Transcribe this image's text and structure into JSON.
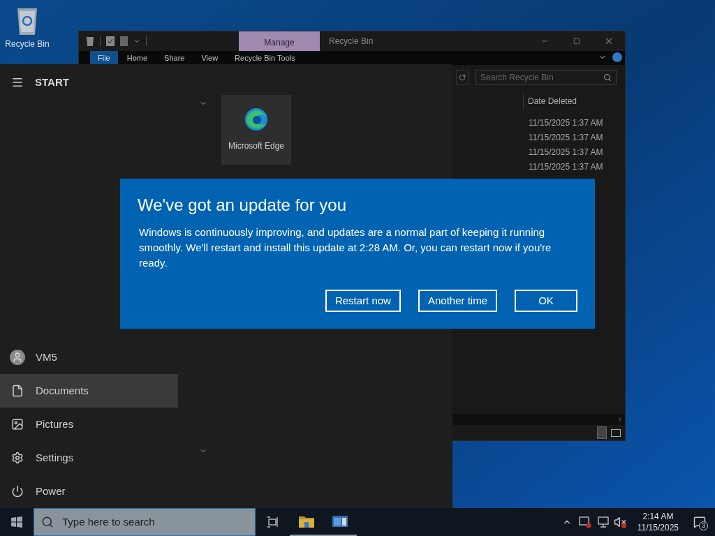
{
  "desktop_icons": [
    {
      "kind": "recycle_bin",
      "label": "Recycle Bin"
    }
  ],
  "explorer": {
    "context_tab": "Manage",
    "title": "Recycle Bin",
    "ribbon_tabs": [
      {
        "label": "File",
        "selected": true
      },
      {
        "label": "Home",
        "selected": false
      },
      {
        "label": "Share",
        "selected": false
      },
      {
        "label": "View",
        "selected": false
      },
      {
        "label": "Recycle Bin Tools",
        "selected": false
      }
    ],
    "search": {
      "placeholder": "Search Recycle Bin"
    },
    "columns": [
      "Date Deleted"
    ],
    "rows": [
      "11/15/2025 1:37 AM",
      "11/15/2025 1:37 AM",
      "11/15/2025 1:37 AM",
      "11/15/2025 1:37 AM"
    ]
  },
  "start_menu": {
    "title": "START",
    "tiles": [
      {
        "label": "Microsoft Edge"
      }
    ],
    "items": [
      {
        "kind": "account",
        "label": "VM5",
        "selected": false
      },
      {
        "kind": "documents",
        "label": "Documents",
        "selected": true
      },
      {
        "kind": "pictures",
        "label": "Pictures",
        "selected": false
      },
      {
        "kind": "settings",
        "label": "Settings",
        "selected": false
      },
      {
        "kind": "power",
        "label": "Power",
        "selected": false
      }
    ]
  },
  "dialog": {
    "title": "We've got an update for you",
    "message": "Windows is continuously improving, and updates are a normal part of keeping it running smoothly. We'll restart and install this update at 2:28 AM. Or, you can restart now if you're ready.",
    "buttons": [
      "Restart now",
      "Another time",
      "OK"
    ]
  },
  "taskbar": {
    "search": {
      "placeholder": "Type here to search"
    },
    "apps": [
      {
        "kind": "task_view",
        "running": false
      },
      {
        "kind": "file_explorer",
        "running": true
      },
      {
        "kind": "window_app",
        "running": true
      }
    ],
    "clock": {
      "time": "2:14 AM",
      "date": "11/15/2025"
    },
    "notification_count": "3"
  }
}
